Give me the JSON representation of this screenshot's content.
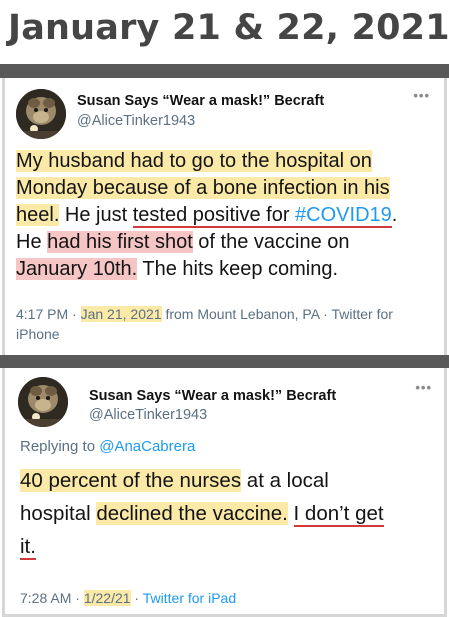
{
  "header": {
    "title": "January 21 & 22, 2021"
  },
  "tweet1": {
    "name": "Susan Says “Wear a mask!” Becraft",
    "handle": "@AliceTinker1943",
    "more": "•••",
    "lines": [
      [
        "My husband had to go to the hospital on"
      ],
      [
        "Monday because of a bone infection in his"
      ],
      [
        "heel.",
        " He just ",
        "tested positive for ",
        "#COVID19",
        "."
      ],
      [
        "He ",
        "had his first shot",
        " of the vaccine on"
      ],
      [
        "January 10th.",
        " The hits keep coming."
      ]
    ],
    "time": "4:17 PM",
    "sep1": " · ",
    "date": "Jan 21, 2021",
    "source": " from Mount Lebanon, PA · Twitter for iPhone"
  },
  "tweet2": {
    "name": "Susan Says “Wear a mask!” Becraft",
    "handle": "@AliceTinker1943",
    "more": "•••",
    "replying_prefix": "Replying to ",
    "replying_to": "@AnaCabrera",
    "lines": [
      [
        "40 percent of the nurses",
        " at a local"
      ],
      [
        "hospital ",
        "declined the vaccine.",
        " ",
        "I don’t get"
      ],
      [
        "it."
      ]
    ],
    "time": "7:28 AM",
    "sep1": " · ",
    "date": "1/22/21",
    "sep2": " · ",
    "source": "Twitter for iPad"
  },
  "colors": {
    "highlight_yellow": "#fbe9a8",
    "highlight_pink": "#f6c6c6",
    "underline_red": "#d23a3a",
    "link_blue": "#1d9bf0",
    "divider": "#595959"
  },
  "icons": {
    "avatar": "profile-photo-avatar",
    "more": "more-options-icon"
  }
}
